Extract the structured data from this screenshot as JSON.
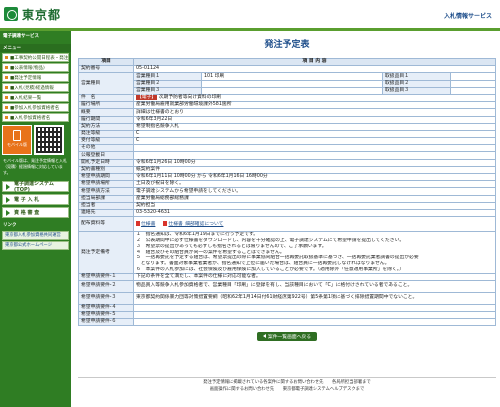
{
  "header": {
    "logo_text": "東京都",
    "service_name": "入札情報サービス"
  },
  "sidebar": {
    "section_title": "電子調達サービス",
    "menu_title": "メニュー",
    "items": [
      {
        "label": "■工事契約公開日程表・発注予定"
      },
      {
        "label": "■公表情報(物品)"
      },
      {
        "label": "■発注予定情報"
      },
      {
        "label": "■入札(見積)経過情報"
      },
      {
        "label": "■入札結果一覧"
      },
      {
        "label": "■参加入札参加資格者名"
      },
      {
        "label": "■入札参加資格者名"
      }
    ],
    "mobile_label": "モバイル版",
    "mobile_note": "モバイル版は、発注予定情報と入札（見積）経過情報に対応しています。",
    "link_section_title": "リンク",
    "big_menus": [
      {
        "label": "電子調達システム(TOP)"
      },
      {
        "label": "電 子 入 札"
      },
      {
        "label": "資 格 審 査"
      }
    ],
    "links": [
      {
        "label": "東京都入札参加資格共同運営"
      },
      {
        "label": "東京都公式ホームページ"
      }
    ]
  },
  "main": {
    "title": "発注予定表",
    "table_headers": {
      "item": "項目",
      "content": "項 目 内 容"
    },
    "contract_no_label": "契約番号",
    "contract_no": "05-01124",
    "business_item_label": "営業種目",
    "business_rows": [
      {
        "sub": "営業種目１",
        "value": "101 印刷",
        "rank_label": "取扱品目１",
        "rank_value": ""
      },
      {
        "sub": "営業種目２",
        "value": "",
        "rank_label": "取扱品目２",
        "rank_value": ""
      },
      {
        "sub": "営業種目３",
        "value": "",
        "rank_label": "取扱品目３",
        "rank_value": ""
      }
    ],
    "name_label": "件　名",
    "name_tag": "【電子】",
    "name_value": "次期予防者等向け資料の印刷",
    "place_label": "履行場所",
    "place_value": "産業労働局雇用就業部労働環境課外581箇所",
    "summary_label": "概要",
    "summary_value": "詳細は仕様書のとおり",
    "period_label": "履行期間",
    "period_value": "令和6年3月22日",
    "method_label": "契約方法",
    "method_value": "希望制指名競争入札",
    "order_label": "発注等級",
    "order_value": "C",
    "accept_label": "受付等級",
    "accept_value": "C",
    "other_label": "その他",
    "bidder_label": "公報登載日",
    "bidder_value": "",
    "open_date_label": "開札予定日時",
    "open_date_value": "令和6年1月26日 10時00分",
    "spec_label": "契約書種別",
    "spec_value": "紙契約案件",
    "apply_period_label": "希望申請期間",
    "apply_period_value": "令和6年1月11日 10時00分 から 令和6年1月16日 16時00分",
    "apply_place_label": "希望申請場所",
    "apply_place_value": "土日及び祝日を除く。",
    "apply_method_label": "希望申請方法",
    "apply_method_value": "電子調達システムから希望申請をしてください。",
    "contact_label": "担当局部課",
    "contact_value": "産業労働局総務部総務課",
    "person_label": "担当者",
    "person_value": "契約担当",
    "phone_label": "連絡先",
    "phone_value": "03-5320-4631",
    "docs_label": "配布資料等",
    "doc_links": [
      {
        "label": "仕様書"
      },
      {
        "label": "仕様書_細部確認について"
      }
    ],
    "remarks_label": "発注予定備考",
    "remarks": [
      "１　指名通知は、令和6年1月19日までに行う予定です。",
      "２　公表期間中に必ず仕様書をダウンロードし、内容を十分確認の上、電子調達システムにて希望申請を提出してください。",
      "３　希望票の提出があっても必ずしも指名されるとは限りませんので、ご了承願います。",
      "４　組合及びその組合員が同一の案件を希望することはできません。",
      "５　一括再委託を予定する組合は、希望票提出の際に事業協同組合一括再委託取扱基準に基づき、一括再委託業者調書の提出が必要",
      "　となります。書面対象事業者業者が、指名通知で上位に届いた場合は、組合員に一括再委託しなければなりません。",
      "６　本案件の入札参加には、社会保険及び雇用保険に加入していることが必要です。（適用除外「任意適用事業所」を除く。）"
    ],
    "expect1_label": "希望申請要件-１",
    "expect1_value": "下記の条件を全て満たし、本案件の仕様に対応可能な者。",
    "expect2_label": "希望申請要件-２",
    "expect2_value": "物品買入等競争入札参加資格者で、営業種目「印刷」に登録を有し、当該種目において「C」に格付けされている者であること。",
    "expect3_label": "希望申請要件-３",
    "expect3_value": "東京都契約関係暴力団等対策措置要綱（昭和62年1月14日付61財経庶第922号）第5条第1項に基づく排除措置期間中でないこと。",
    "expect4_label": "希望申請要件-４",
    "expect5_label": "希望申請要件-５",
    "expect6_label": "希望申請要件-６",
    "back_button": "案件一覧画面へ戻る"
  },
  "footer": {
    "line1": "発注予定情報に掲載されている各案件に関するお問い合わせ先　　各局所担当部署まで",
    "line2": "画面操作に関するお問い合わせ先　　東京都電子調達システムヘルプデスクまで"
  }
}
